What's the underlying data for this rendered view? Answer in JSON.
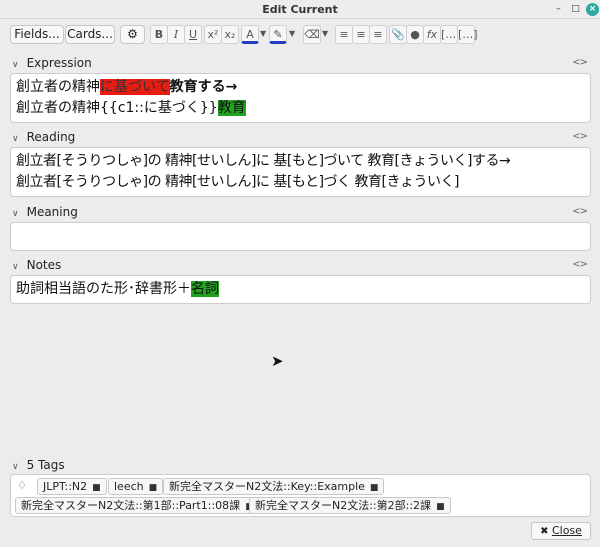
{
  "window": {
    "title": "Edit Current"
  },
  "toolbar": {
    "fields_label": "Fields...",
    "cards_label": "Cards..."
  },
  "fields": [
    {
      "label": "Expression"
    },
    {
      "label": "Reading",
      "line1": "創立者[そうりつしゃ]の 精神[せいしん]に 基[もと]づいて 教育[きょういく]する→",
      "line2": "創立者[そうりつしゃ]の 精神[せいしん]に 基[もと]づく 教育[きょういく]"
    },
    {
      "label": "Meaning"
    },
    {
      "label": "Notes"
    }
  ],
  "expression": {
    "l1_a": "創立者の精神",
    "l1_b": "に基づいて",
    "l1_c": "教育する→",
    "l2_a": "創立者の精神{{c1::に基づく}}",
    "l2_b": "教育"
  },
  "notes": {
    "a": "助詞相当語のた形･辞書形＋",
    "b": "名詞"
  },
  "tags": {
    "count_label": "5 Tags",
    "items": [
      "JLPT::N2",
      "leech",
      "新完全マスターN2文法::Key::Example",
      "新完全マスターN2文法::第1部::Part1::08課",
      "新完全マスターN2文法::第2部::2課"
    ]
  },
  "footer": {
    "close_label": "Close"
  }
}
